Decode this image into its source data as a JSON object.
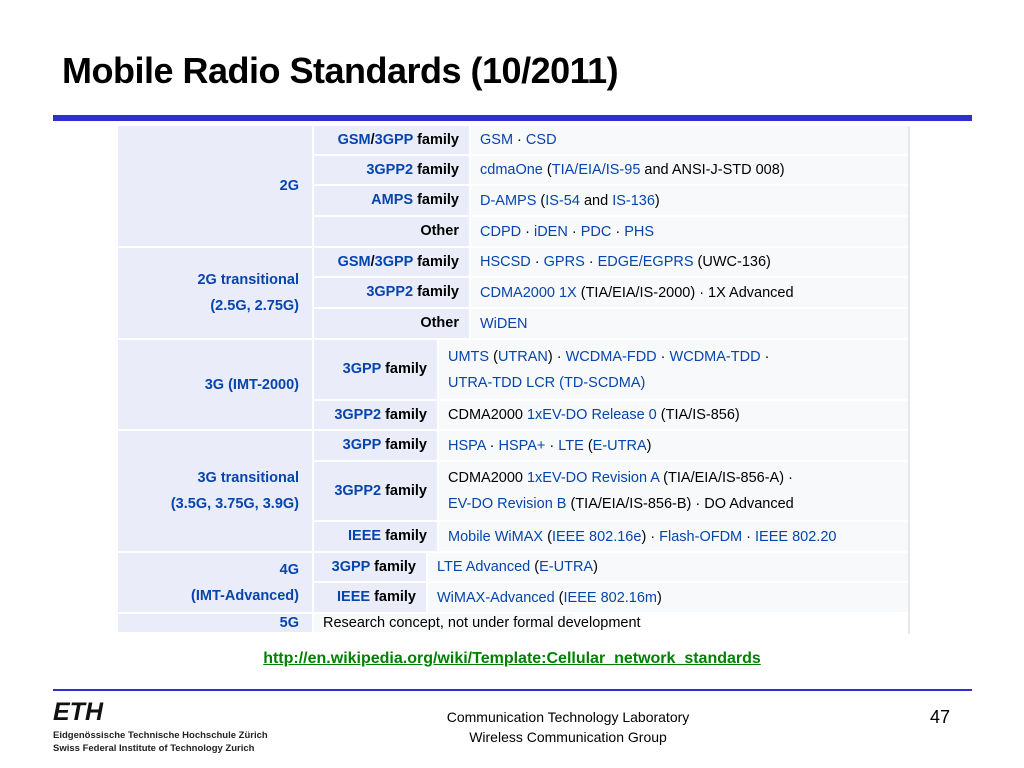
{
  "title": "Mobile Radio Standards (10/2011)",
  "colors": {
    "accent": "#2f2fcc",
    "link": "#0645ad",
    "url": "#008000",
    "header_bg": "#eaecf9",
    "cell_bg": "#f8f9fa"
  },
  "table": {
    "generations": [
      {
        "lines": [
          "2G"
        ]
      },
      {
        "lines": [
          "2G transitional",
          "(2.5G, 2.75G)"
        ]
      },
      {
        "lines": [
          "3G (IMT-2000)"
        ]
      },
      {
        "lines": [
          "3G transitional",
          "(3.5G, 3.75G, 3.9G)"
        ]
      },
      {
        "lines": [
          "4G",
          "(IMT-Advanced)"
        ]
      },
      {
        "lines": [
          "5G"
        ]
      }
    ],
    "rows": [
      {
        "family": [
          {
            "t": "GSM",
            "link": true
          },
          {
            "t": "/"
          },
          {
            "t": "3GPP",
            "link": true
          },
          {
            "t": " family"
          }
        ],
        "lines": [
          [
            {
              "t": "GSM",
              "link": true
            },
            {
              "t": " · "
            },
            {
              "t": "CSD",
              "link": true
            }
          ]
        ]
      },
      {
        "family": [
          {
            "t": "3GPP2",
            "link": true
          },
          {
            "t": " family"
          }
        ],
        "lines": [
          [
            {
              "t": "cdmaOne",
              "link": true
            },
            {
              "t": " ("
            },
            {
              "t": "TIA/EIA/IS-95",
              "link": true
            },
            {
              "t": " and ANSI-J-STD 008)"
            }
          ]
        ]
      },
      {
        "family": [
          {
            "t": "AMPS",
            "link": true
          },
          {
            "t": " family"
          }
        ],
        "lines": [
          [
            {
              "t": "D-AMPS",
              "link": true
            },
            {
              "t": " ("
            },
            {
              "t": "IS-54",
              "link": true
            },
            {
              "t": " and "
            },
            {
              "t": "IS-136",
              "link": true
            },
            {
              "t": ")"
            }
          ]
        ]
      },
      {
        "family": [
          {
            "t": "Other"
          }
        ],
        "lines": [
          [
            {
              "t": "CDPD",
              "link": true
            },
            {
              "t": " · "
            },
            {
              "t": "iDEN",
              "link": true
            },
            {
              "t": " · "
            },
            {
              "t": "PDC",
              "link": true
            },
            {
              "t": " · "
            },
            {
              "t": "PHS",
              "link": true
            }
          ]
        ]
      },
      {
        "family": [
          {
            "t": "GSM",
            "link": true
          },
          {
            "t": "/"
          },
          {
            "t": "3GPP",
            "link": true
          },
          {
            "t": " family"
          }
        ],
        "lines": [
          [
            {
              "t": "HSCSD",
              "link": true
            },
            {
              "t": " · "
            },
            {
              "t": "GPRS",
              "link": true
            },
            {
              "t": " · "
            },
            {
              "t": "EDGE/EGPRS",
              "link": true
            },
            {
              "t": " (UWC-136)"
            }
          ]
        ]
      },
      {
        "family": [
          {
            "t": "3GPP2",
            "link": true
          },
          {
            "t": " family"
          }
        ],
        "lines": [
          [
            {
              "t": "CDMA2000 1X",
              "link": true
            },
            {
              "t": " (TIA/EIA/IS-2000) · 1X Advanced"
            }
          ]
        ]
      },
      {
        "family": [
          {
            "t": "Other"
          }
        ],
        "lines": [
          [
            {
              "t": "WiDEN",
              "link": true
            }
          ]
        ]
      },
      {
        "family": [
          {
            "t": "3GPP",
            "link": true
          },
          {
            "t": " family"
          }
        ],
        "lines": [
          [
            {
              "t": "UMTS",
              "link": true
            },
            {
              "t": " ("
            },
            {
              "t": "UTRAN",
              "link": true
            },
            {
              "t": ") · "
            },
            {
              "t": "WCDMA-FDD",
              "link": true
            },
            {
              "t": " · "
            },
            {
              "t": "WCDMA-TDD",
              "link": true
            },
            {
              "t": " ·"
            }
          ],
          [
            {
              "t": "UTRA-TDD LCR (TD-SCDMA)",
              "link": true
            }
          ]
        ]
      },
      {
        "family": [
          {
            "t": "3GPP2",
            "link": true
          },
          {
            "t": " family"
          }
        ],
        "lines": [
          [
            {
              "t": "CDMA2000 "
            },
            {
              "t": "1xEV-DO Release 0",
              "link": true
            },
            {
              "t": " (TIA/IS-856)"
            }
          ]
        ]
      },
      {
        "family": [
          {
            "t": "3GPP",
            "link": true
          },
          {
            "t": " family"
          }
        ],
        "lines": [
          [
            {
              "t": "HSPA",
              "link": true
            },
            {
              "t": " · "
            },
            {
              "t": "HSPA+",
              "link": true
            },
            {
              "t": " · "
            },
            {
              "t": "LTE",
              "link": true
            },
            {
              "t": " ("
            },
            {
              "t": "E-UTRA",
              "link": true
            },
            {
              "t": ")"
            }
          ]
        ]
      },
      {
        "family": [
          {
            "t": "3GPP2",
            "link": true
          },
          {
            "t": " family"
          }
        ],
        "lines": [
          [
            {
              "t": "CDMA2000 "
            },
            {
              "t": "1xEV-DO Revision A",
              "link": true
            },
            {
              "t": " (TIA/EIA/IS-856-A) ·"
            }
          ],
          [
            {
              "t": "EV-DO Revision B",
              "link": true
            },
            {
              "t": " (TIA/EIA/IS-856-B) · DO Advanced"
            }
          ]
        ]
      },
      {
        "family": [
          {
            "t": "IEEE",
            "link": true
          },
          {
            "t": " family"
          }
        ],
        "lines": [
          [
            {
              "t": "Mobile WiMAX",
              "link": true
            },
            {
              "t": " ("
            },
            {
              "t": "IEEE 802.16e",
              "link": true
            },
            {
              "t": ") · "
            },
            {
              "t": "Flash-OFDM",
              "link": true
            },
            {
              "t": " · "
            },
            {
              "t": "IEEE 802.20",
              "link": true
            }
          ]
        ]
      },
      {
        "family": [
          {
            "t": "3GPP",
            "link": true
          },
          {
            "t": " family"
          }
        ],
        "lines": [
          [
            {
              "t": "LTE Advanced",
              "link": true
            },
            {
              "t": " ("
            },
            {
              "t": "E-UTRA",
              "link": true
            },
            {
              "t": ")"
            }
          ]
        ]
      },
      {
        "family": [
          {
            "t": "IEEE",
            "link": true
          },
          {
            "t": " family"
          }
        ],
        "lines": [
          [
            {
              "t": "WiMAX-Advanced",
              "link": true
            },
            {
              "t": " ("
            },
            {
              "t": "IEEE 802.16m",
              "link": true
            },
            {
              "t": ")"
            }
          ]
        ]
      },
      {
        "lines": [
          [
            {
              "t": "Research concept, not under formal development"
            }
          ]
        ]
      }
    ]
  },
  "source_link": "http://en.wikipedia.org/wiki/Template:Cellular_network_standards",
  "footer": {
    "logo_text": "ETH",
    "institution_line1": "Eidgenössische Technische Hochschule Zürich",
    "institution_line2": "Swiss Federal Institute of Technology Zurich",
    "lab_line1": "Communication Technology Laboratory",
    "lab_line2": "Wireless Communication Group",
    "page_number": "47"
  }
}
